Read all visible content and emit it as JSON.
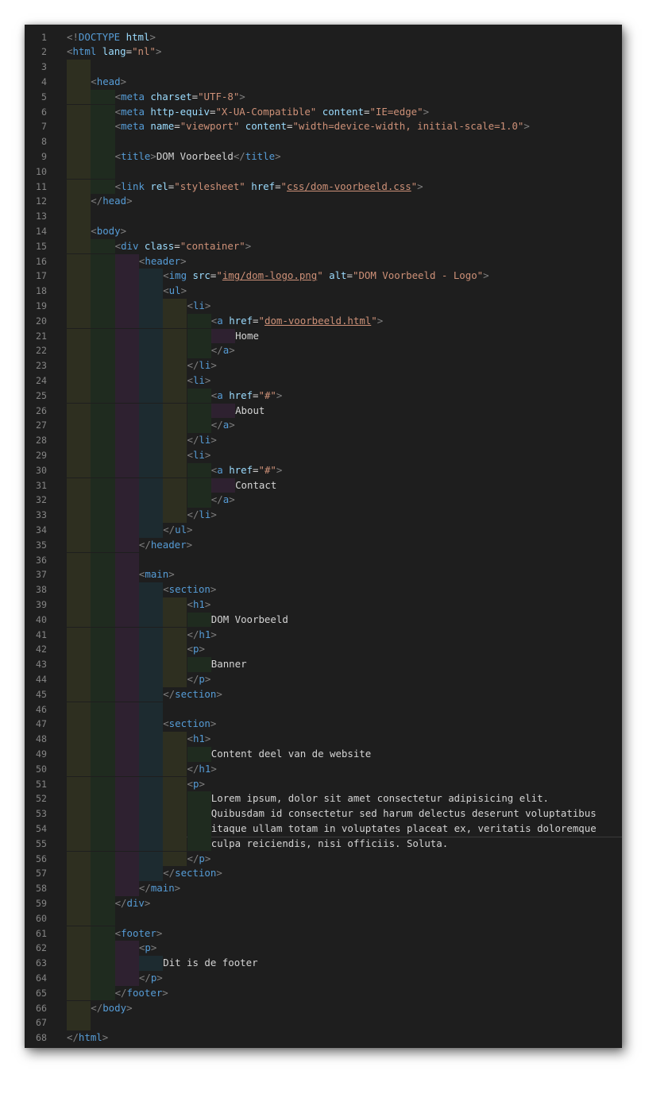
{
  "colors": {
    "background": "#1e1e1e",
    "tag": "#569cd6",
    "attribute": "#9cdcfe",
    "string": "#ce9178",
    "text": "#d4d4d4",
    "bracket": "#808080",
    "line_number": "#858585",
    "indent_guides": [
      "#2e2f20",
      "#1f2b1f",
      "#2e2130",
      "#1d2b30"
    ]
  },
  "editor": {
    "lines": [
      {
        "n": "1",
        "i": 0,
        "tokens": [
          [
            "b",
            "<!"
          ],
          [
            "t",
            "DOCTYPE"
          ],
          [
            "x",
            " "
          ],
          [
            "a",
            "html"
          ],
          [
            "b",
            ">"
          ]
        ]
      },
      {
        "n": "2",
        "i": 0,
        "tokens": [
          [
            "b",
            "<"
          ],
          [
            "t",
            "html"
          ],
          [
            "x",
            " "
          ],
          [
            "a",
            "lang"
          ],
          [
            "x",
            "="
          ],
          [
            "s",
            "\"nl\""
          ],
          [
            "b",
            ">"
          ]
        ]
      },
      {
        "n": "3",
        "i": 1,
        "tokens": []
      },
      {
        "n": "4",
        "i": 1,
        "tokens": [
          [
            "b",
            "<"
          ],
          [
            "t",
            "head"
          ],
          [
            "b",
            ">"
          ]
        ]
      },
      {
        "n": "5",
        "i": 2,
        "tokens": [
          [
            "b",
            "<"
          ],
          [
            "t",
            "meta"
          ],
          [
            "x",
            " "
          ],
          [
            "a",
            "charset"
          ],
          [
            "x",
            "="
          ],
          [
            "s",
            "\"UTF-8\""
          ],
          [
            "b",
            ">"
          ]
        ]
      },
      {
        "n": "6",
        "i": 2,
        "tokens": [
          [
            "b",
            "<"
          ],
          [
            "t",
            "meta"
          ],
          [
            "x",
            " "
          ],
          [
            "a",
            "http-equiv"
          ],
          [
            "x",
            "="
          ],
          [
            "s",
            "\"X-UA-Compatible\""
          ],
          [
            "x",
            " "
          ],
          [
            "a",
            "content"
          ],
          [
            "x",
            "="
          ],
          [
            "s",
            "\"IE=edge\""
          ],
          [
            "b",
            ">"
          ]
        ]
      },
      {
        "n": "7",
        "i": 2,
        "tokens": [
          [
            "b",
            "<"
          ],
          [
            "t",
            "meta"
          ],
          [
            "x",
            " "
          ],
          [
            "a",
            "name"
          ],
          [
            "x",
            "="
          ],
          [
            "s",
            "\"viewport\""
          ],
          [
            "x",
            " "
          ],
          [
            "a",
            "content"
          ],
          [
            "x",
            "="
          ],
          [
            "s",
            "\"width=device-width, initial-scale=1.0\""
          ],
          [
            "b",
            ">"
          ]
        ]
      },
      {
        "n": "8",
        "i": 2,
        "tokens": []
      },
      {
        "n": "9",
        "i": 2,
        "tokens": [
          [
            "b",
            "<"
          ],
          [
            "t",
            "title"
          ],
          [
            "b",
            ">"
          ],
          [
            "x",
            "DOM Voorbeeld"
          ],
          [
            "b",
            "</"
          ],
          [
            "t",
            "title"
          ],
          [
            "b",
            ">"
          ]
        ]
      },
      {
        "n": "10",
        "i": 2,
        "tokens": []
      },
      {
        "n": "11",
        "i": 2,
        "tokens": [
          [
            "b",
            "<"
          ],
          [
            "t",
            "link"
          ],
          [
            "x",
            " "
          ],
          [
            "a",
            "rel"
          ],
          [
            "x",
            "="
          ],
          [
            "s",
            "\"stylesheet\""
          ],
          [
            "x",
            " "
          ],
          [
            "a",
            "href"
          ],
          [
            "x",
            "="
          ],
          [
            "s",
            "\""
          ],
          [
            "l",
            "css/dom-voorbeeld.css"
          ],
          [
            "s",
            "\""
          ],
          [
            "b",
            ">"
          ]
        ]
      },
      {
        "n": "12",
        "i": 1,
        "tokens": [
          [
            "b",
            "</"
          ],
          [
            "t",
            "head"
          ],
          [
            "b",
            ">"
          ]
        ]
      },
      {
        "n": "13",
        "i": 1,
        "tokens": []
      },
      {
        "n": "14",
        "i": 1,
        "tokens": [
          [
            "b",
            "<"
          ],
          [
            "t",
            "body"
          ],
          [
            "b",
            ">"
          ]
        ]
      },
      {
        "n": "15",
        "i": 2,
        "tokens": [
          [
            "b",
            "<"
          ],
          [
            "t",
            "div"
          ],
          [
            "x",
            " "
          ],
          [
            "a",
            "class"
          ],
          [
            "x",
            "="
          ],
          [
            "s",
            "\"container\""
          ],
          [
            "b",
            ">"
          ]
        ]
      },
      {
        "n": "16",
        "i": 3,
        "tokens": [
          [
            "b",
            "<"
          ],
          [
            "t",
            "header"
          ],
          [
            "b",
            ">"
          ]
        ]
      },
      {
        "n": "17",
        "i": 4,
        "tokens": [
          [
            "b",
            "<"
          ],
          [
            "t",
            "img"
          ],
          [
            "x",
            " "
          ],
          [
            "a",
            "src"
          ],
          [
            "x",
            "="
          ],
          [
            "s",
            "\""
          ],
          [
            "l",
            "img/dom-logo.png"
          ],
          [
            "s",
            "\""
          ],
          [
            "x",
            " "
          ],
          [
            "a",
            "alt"
          ],
          [
            "x",
            "="
          ],
          [
            "s",
            "\"DOM Voorbeeld - Logo\""
          ],
          [
            "b",
            ">"
          ]
        ]
      },
      {
        "n": "18",
        "i": 4,
        "tokens": [
          [
            "b",
            "<"
          ],
          [
            "t",
            "ul"
          ],
          [
            "b",
            ">"
          ]
        ]
      },
      {
        "n": "19",
        "i": 5,
        "tokens": [
          [
            "b",
            "<"
          ],
          [
            "t",
            "li"
          ],
          [
            "b",
            ">"
          ]
        ]
      },
      {
        "n": "20",
        "i": 6,
        "tokens": [
          [
            "b",
            "<"
          ],
          [
            "t",
            "a"
          ],
          [
            "x",
            " "
          ],
          [
            "a",
            "href"
          ],
          [
            "x",
            "="
          ],
          [
            "s",
            "\""
          ],
          [
            "l",
            "dom-voorbeeld.html"
          ],
          [
            "s",
            "\""
          ],
          [
            "b",
            ">"
          ]
        ]
      },
      {
        "n": "21",
        "i": 7,
        "tokens": [
          [
            "x",
            "Home"
          ]
        ]
      },
      {
        "n": "22",
        "i": 6,
        "tokens": [
          [
            "b",
            "</"
          ],
          [
            "t",
            "a"
          ],
          [
            "b",
            ">"
          ]
        ]
      },
      {
        "n": "23",
        "i": 5,
        "tokens": [
          [
            "b",
            "</"
          ],
          [
            "t",
            "li"
          ],
          [
            "b",
            ">"
          ]
        ]
      },
      {
        "n": "24",
        "i": 5,
        "tokens": [
          [
            "b",
            "<"
          ],
          [
            "t",
            "li"
          ],
          [
            "b",
            ">"
          ]
        ]
      },
      {
        "n": "25",
        "i": 6,
        "tokens": [
          [
            "b",
            "<"
          ],
          [
            "t",
            "a"
          ],
          [
            "x",
            " "
          ],
          [
            "a",
            "href"
          ],
          [
            "x",
            "="
          ],
          [
            "s",
            "\"#\""
          ],
          [
            "b",
            ">"
          ]
        ]
      },
      {
        "n": "26",
        "i": 7,
        "tokens": [
          [
            "x",
            "About"
          ]
        ]
      },
      {
        "n": "27",
        "i": 6,
        "tokens": [
          [
            "b",
            "</"
          ],
          [
            "t",
            "a"
          ],
          [
            "b",
            ">"
          ]
        ]
      },
      {
        "n": "28",
        "i": 5,
        "tokens": [
          [
            "b",
            "</"
          ],
          [
            "t",
            "li"
          ],
          [
            "b",
            ">"
          ]
        ]
      },
      {
        "n": "29",
        "i": 5,
        "tokens": [
          [
            "b",
            "<"
          ],
          [
            "t",
            "li"
          ],
          [
            "b",
            ">"
          ]
        ]
      },
      {
        "n": "30",
        "i": 6,
        "tokens": [
          [
            "b",
            "<"
          ],
          [
            "t",
            "a"
          ],
          [
            "x",
            " "
          ],
          [
            "a",
            "href"
          ],
          [
            "x",
            "="
          ],
          [
            "s",
            "\"#\""
          ],
          [
            "b",
            ">"
          ]
        ]
      },
      {
        "n": "31",
        "i": 7,
        "tokens": [
          [
            "x",
            "Contact"
          ]
        ]
      },
      {
        "n": "32",
        "i": 6,
        "tokens": [
          [
            "b",
            "</"
          ],
          [
            "t",
            "a"
          ],
          [
            "b",
            ">"
          ]
        ]
      },
      {
        "n": "33",
        "i": 5,
        "tokens": [
          [
            "b",
            "</"
          ],
          [
            "t",
            "li"
          ],
          [
            "b",
            ">"
          ]
        ]
      },
      {
        "n": "34",
        "i": 4,
        "tokens": [
          [
            "b",
            "</"
          ],
          [
            "t",
            "ul"
          ],
          [
            "b",
            ">"
          ]
        ]
      },
      {
        "n": "35",
        "i": 3,
        "tokens": [
          [
            "b",
            "</"
          ],
          [
            "t",
            "header"
          ],
          [
            "b",
            ">"
          ]
        ]
      },
      {
        "n": "36",
        "i": 3,
        "tokens": []
      },
      {
        "n": "37",
        "i": 3,
        "tokens": [
          [
            "b",
            "<"
          ],
          [
            "t",
            "main"
          ],
          [
            "b",
            ">"
          ]
        ]
      },
      {
        "n": "38",
        "i": 4,
        "tokens": [
          [
            "b",
            "<"
          ],
          [
            "t",
            "section"
          ],
          [
            "b",
            ">"
          ]
        ]
      },
      {
        "n": "39",
        "i": 5,
        "tokens": [
          [
            "b",
            "<"
          ],
          [
            "t",
            "h1"
          ],
          [
            "b",
            ">"
          ]
        ]
      },
      {
        "n": "40",
        "i": 6,
        "tokens": [
          [
            "x",
            "DOM Voorbeeld"
          ]
        ]
      },
      {
        "n": "41",
        "i": 5,
        "tokens": [
          [
            "b",
            "</"
          ],
          [
            "t",
            "h1"
          ],
          [
            "b",
            ">"
          ]
        ]
      },
      {
        "n": "42",
        "i": 5,
        "tokens": [
          [
            "b",
            "<"
          ],
          [
            "t",
            "p"
          ],
          [
            "b",
            ">"
          ]
        ]
      },
      {
        "n": "43",
        "i": 6,
        "tokens": [
          [
            "x",
            "Banner"
          ]
        ]
      },
      {
        "n": "44",
        "i": 5,
        "tokens": [
          [
            "b",
            "</"
          ],
          [
            "t",
            "p"
          ],
          [
            "b",
            ">"
          ]
        ]
      },
      {
        "n": "45",
        "i": 4,
        "tokens": [
          [
            "b",
            "</"
          ],
          [
            "t",
            "section"
          ],
          [
            "b",
            ">"
          ]
        ]
      },
      {
        "n": "46",
        "i": 4,
        "tokens": []
      },
      {
        "n": "47",
        "i": 4,
        "tokens": [
          [
            "b",
            "<"
          ],
          [
            "t",
            "section"
          ],
          [
            "b",
            ">"
          ]
        ]
      },
      {
        "n": "48",
        "i": 5,
        "tokens": [
          [
            "b",
            "<"
          ],
          [
            "t",
            "h1"
          ],
          [
            "b",
            ">"
          ]
        ]
      },
      {
        "n": "49",
        "i": 6,
        "tokens": [
          [
            "x",
            "Content deel van de website"
          ]
        ]
      },
      {
        "n": "50",
        "i": 5,
        "tokens": [
          [
            "b",
            "</"
          ],
          [
            "t",
            "h1"
          ],
          [
            "b",
            ">"
          ]
        ]
      },
      {
        "n": "51",
        "i": 5,
        "tokens": [
          [
            "b",
            "<"
          ],
          [
            "t",
            "p"
          ],
          [
            "b",
            ">"
          ]
        ]
      },
      {
        "n": "52",
        "i": 6,
        "tokens": [
          [
            "x",
            "Lorem ipsum, dolor sit amet consectetur adipisicing elit."
          ]
        ]
      },
      {
        "n": "53",
        "i": 6,
        "tokens": [
          [
            "x",
            "Quibusdam id consectetur sed harum delectus deserunt voluptatibus"
          ]
        ]
      },
      {
        "n": "54",
        "i": 6,
        "tokens": [
          [
            "x",
            "itaque ullam totam in voluptates placeat ex, veritatis doloremque"
          ]
        ]
      },
      {
        "n": "55",
        "i": 6,
        "tokens": [
          [
            "x",
            "culpa reiciendis, nisi officiis. Soluta."
          ]
        ]
      },
      {
        "n": "56",
        "i": 5,
        "tokens": [
          [
            "b",
            "</"
          ],
          [
            "t",
            "p"
          ],
          [
            "b",
            ">"
          ]
        ]
      },
      {
        "n": "57",
        "i": 4,
        "tokens": [
          [
            "b",
            "</"
          ],
          [
            "t",
            "section"
          ],
          [
            "b",
            ">"
          ]
        ]
      },
      {
        "n": "58",
        "i": 3,
        "tokens": [
          [
            "b",
            "</"
          ],
          [
            "t",
            "main"
          ],
          [
            "b",
            ">"
          ]
        ]
      },
      {
        "n": "59",
        "i": 2,
        "tokens": [
          [
            "b",
            "</"
          ],
          [
            "t",
            "div"
          ],
          [
            "b",
            ">"
          ]
        ]
      },
      {
        "n": "60",
        "i": 2,
        "tokens": []
      },
      {
        "n": "61",
        "i": 2,
        "tokens": [
          [
            "b",
            "<"
          ],
          [
            "t",
            "footer"
          ],
          [
            "b",
            ">"
          ]
        ]
      },
      {
        "n": "62",
        "i": 3,
        "tokens": [
          [
            "b",
            "<"
          ],
          [
            "t",
            "p"
          ],
          [
            "b",
            ">"
          ]
        ]
      },
      {
        "n": "63",
        "i": 4,
        "tokens": [
          [
            "x",
            "Dit is de footer"
          ]
        ]
      },
      {
        "n": "64",
        "i": 3,
        "tokens": [
          [
            "b",
            "</"
          ],
          [
            "t",
            "p"
          ],
          [
            "b",
            ">"
          ]
        ]
      },
      {
        "n": "65",
        "i": 2,
        "tokens": [
          [
            "b",
            "</"
          ],
          [
            "t",
            "footer"
          ],
          [
            "b",
            ">"
          ]
        ]
      },
      {
        "n": "66",
        "i": 1,
        "tokens": [
          [
            "b",
            "</"
          ],
          [
            "t",
            "body"
          ],
          [
            "b",
            ">"
          ]
        ]
      },
      {
        "n": "67",
        "i": 1,
        "tokens": []
      },
      {
        "n": "68",
        "i": 0,
        "tokens": [
          [
            "b",
            "</"
          ],
          [
            "t",
            "html"
          ],
          [
            "b",
            ">"
          ]
        ]
      }
    ]
  }
}
